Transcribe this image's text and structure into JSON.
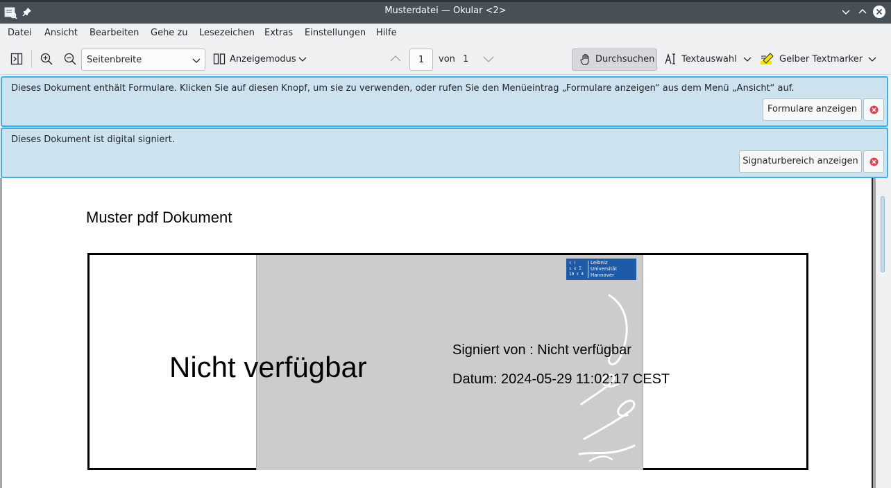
{
  "window": {
    "title": "Musterdatei — Okular <2>"
  },
  "menu": [
    "Datei",
    "Ansicht",
    "Bearbeiten",
    "Gehe zu",
    "Lesezeichen",
    "Extras",
    "Einstellungen",
    "Hilfe"
  ],
  "toolbar": {
    "zoom_mode": "Seitenbreite",
    "view_mode_label": "Anzeigemodus",
    "current_page": "1",
    "of_label": "von",
    "total_pages": "1",
    "browse_label": "Durchsuchen",
    "text_select_label": "Textauswahl",
    "highlighter_label": "Gelber Textmarker"
  },
  "infobars": {
    "forms": {
      "message": "Dieses Dokument enthält Formulare. Klicken Sie auf diesen Knopf, um sie zu verwenden, oder rufen Sie den Menüeintrag „Formulare anzeigen“ aus dem Menü „Ansicht“ auf.",
      "button": "Formulare anzeigen"
    },
    "signature": {
      "message": "Dieses Dokument ist digital signiert.",
      "button": "Signaturbereich anzeigen"
    }
  },
  "document": {
    "title": "Muster pdf Dokument",
    "signature": {
      "name": "Nicht verfügbar",
      "signed_by": "Signiert von : Nicht verfügbar",
      "date": "Datum: 2024-05-29 11:02:17 CEST",
      "logo_lines": [
        "Leibniz",
        "Universität",
        "Hannover"
      ]
    }
  },
  "colors": {
    "titlebar": "#475057",
    "infobar_bg": "#cce3ef",
    "infobar_border": "#3daee9",
    "logo_blue": "#1d5aa7"
  }
}
